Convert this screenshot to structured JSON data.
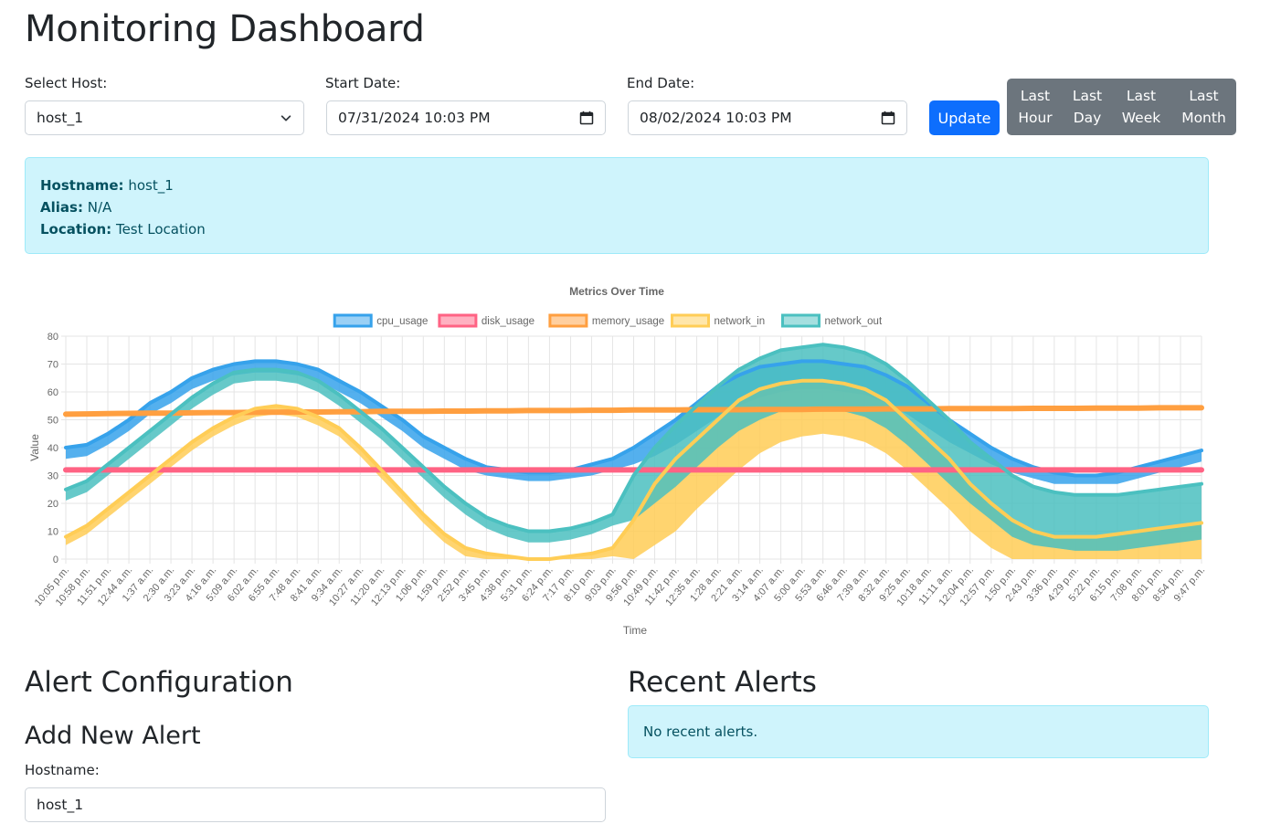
{
  "page": {
    "title": "Monitoring Dashboard"
  },
  "filters": {
    "host_label": "Select Host:",
    "host_value": "host_1",
    "start_label": "Start Date:",
    "start_value": "07/31/2024 10:03  PM",
    "end_label": "End Date:",
    "end_value": "08/02/2024 10:03  PM",
    "update_label": "Update",
    "ranges": [
      {
        "label": "Last\nHour"
      },
      {
        "label": "Last\nDay"
      },
      {
        "label": "Last\nWeek"
      },
      {
        "label": "Last\nMonth"
      }
    ]
  },
  "host_info": {
    "hostname_key": "Hostname:",
    "hostname_val": "host_1",
    "alias_key": "Alias:",
    "alias_val": "N/A",
    "location_key": "Location:",
    "location_val": "Test Location"
  },
  "chart_data": {
    "type": "line",
    "title": "Metrics Over Time",
    "xlabel": "Time",
    "ylabel": "Value",
    "ylim": [
      0,
      80
    ],
    "yticks": [
      0,
      10,
      20,
      30,
      40,
      50,
      60,
      70,
      80
    ],
    "grid": true,
    "legend_position": "top",
    "x_ticks": [
      "10:05 p.m.",
      "10:58 p.m.",
      "11:51 p.m.",
      "12:44 a.m.",
      "1:37 a.m.",
      "2:30 a.m.",
      "3:23 a.m.",
      "4:16 a.m.",
      "5:09 a.m.",
      "6:02 a.m.",
      "6:55 a.m.",
      "7:48 a.m.",
      "8:41 a.m.",
      "9:34 a.m.",
      "10:27 a.m.",
      "11:20 a.m.",
      "12:13 p.m.",
      "1:06 p.m.",
      "1:59 p.m.",
      "2:52 p.m.",
      "3:45 p.m.",
      "4:38 p.m.",
      "5:31 p.m.",
      "6:24 p.m.",
      "7:17 p.m.",
      "8:10 p.m.",
      "9:03 p.m.",
      "9:56 p.m.",
      "10:49 p.m.",
      "11:42 p.m.",
      "12:35 a.m.",
      "1:28 a.m.",
      "2:21 a.m.",
      "3:14 a.m.",
      "4:07 a.m.",
      "5:00 a.m.",
      "5:53 a.m.",
      "6:46 a.m.",
      "7:39 a.m.",
      "8:32 a.m.",
      "9:25 a.m.",
      "10:18 a.m.",
      "11:11 a.m.",
      "12:04 p.m.",
      "12:57 p.m.",
      "1:50 p.m.",
      "2:43 p.m.",
      "3:36 p.m.",
      "4:29 p.m.",
      "5:22 p.m.",
      "6:15 p.m.",
      "7:08 p.m.",
      "8:01 p.m.",
      "8:54 p.m.",
      "9:47 p.m."
    ],
    "series": [
      {
        "name": "cpu_usage",
        "color": "#36a2eb",
        "fill": "#9ad0f5",
        "values": [
          40,
          41,
          45,
          50,
          56,
          60,
          65,
          68,
          70,
          71,
          71,
          70,
          68,
          64,
          60,
          55,
          50,
          44,
          40,
          36,
          33,
          32,
          31,
          31,
          32,
          34,
          36,
          40,
          45,
          50,
          56,
          62,
          66,
          69,
          70,
          71,
          71,
          70,
          69,
          66,
          62,
          56,
          50,
          45,
          40,
          36,
          33,
          31,
          30,
          30,
          31,
          33,
          35,
          37,
          39
        ],
        "band_min": [
          36,
          37,
          41,
          46,
          52,
          56,
          61,
          64,
          66,
          67,
          67,
          66,
          64,
          60,
          56,
          51,
          46,
          40,
          36,
          32,
          30,
          29,
          28,
          28,
          29,
          30,
          32,
          34,
          37,
          41,
          46,
          51,
          55,
          58,
          60,
          61,
          61,
          60,
          59,
          56,
          52,
          47,
          42,
          38,
          34,
          31,
          29,
          27,
          27,
          27,
          27,
          29,
          31,
          33,
          35
        ]
      },
      {
        "name": "disk_usage",
        "color": "#ff6384",
        "fill": "#ffb1c1",
        "values": [
          32,
          32,
          32,
          32,
          32,
          32,
          32,
          32,
          32,
          32,
          32,
          32,
          32,
          32,
          32,
          32,
          32,
          32,
          32,
          32,
          32,
          32,
          32,
          32,
          32,
          32,
          32,
          32,
          32,
          32,
          32,
          32,
          32,
          32,
          32,
          32,
          32,
          32,
          32,
          32,
          32,
          32,
          32,
          32,
          32,
          32,
          32,
          32,
          32,
          32,
          32,
          32,
          32,
          32,
          32
        ]
      },
      {
        "name": "memory_usage",
        "color": "#ff9f40",
        "fill": "#ffcf9f",
        "values": [
          52,
          52.1,
          52.2,
          52.3,
          52.4,
          52.4,
          52.5,
          52.6,
          52.6,
          52.7,
          52.7,
          52.8,
          52.8,
          52.9,
          52.9,
          53,
          53,
          53,
          53.1,
          53.1,
          53.2,
          53.2,
          53.3,
          53.3,
          53.3,
          53.4,
          53.4,
          53.5,
          53.5,
          53.5,
          53.6,
          53.6,
          53.6,
          53.7,
          53.7,
          53.7,
          53.8,
          53.8,
          53.8,
          53.9,
          53.9,
          53.9,
          54,
          54,
          54,
          54,
          54.1,
          54.1,
          54.1,
          54.2,
          54.2,
          54.2,
          54.3,
          54.3,
          54.3
        ]
      },
      {
        "name": "network_in",
        "color": "#ffcd56",
        "fill": "#ffe6aa",
        "values": [
          8,
          12,
          18,
          24,
          30,
          36,
          42,
          47,
          51,
          54,
          55,
          54,
          51,
          47,
          40,
          32,
          24,
          16,
          9,
          4,
          2,
          1,
          0,
          0,
          1,
          2,
          4,
          14,
          27,
          36,
          43,
          50,
          57,
          61,
          63,
          64,
          64,
          63,
          61,
          57,
          50,
          43,
          36,
          27,
          20,
          14,
          10,
          8,
          8,
          8,
          9,
          10,
          11,
          12,
          13
        ],
        "band_min": [
          5,
          9,
          15,
          21,
          27,
          33,
          39,
          44,
          48,
          51,
          52,
          51,
          48,
          44,
          37,
          29,
          21,
          13,
          6,
          1,
          0,
          0,
          0,
          0,
          0,
          0,
          1,
          0,
          5,
          10,
          18,
          25,
          32,
          38,
          42,
          44,
          45,
          44,
          42,
          38,
          32,
          25,
          18,
          10,
          4,
          0,
          0,
          0,
          0,
          0,
          0,
          0,
          0,
          0,
          0
        ]
      },
      {
        "name": "network_out",
        "color": "#4bc0c0",
        "fill": "#a5dfdf",
        "values": [
          25,
          28,
          34,
          40,
          46,
          52,
          58,
          63,
          67,
          68,
          68,
          67,
          64,
          59,
          53,
          47,
          40,
          33,
          26,
          20,
          15,
          12,
          10,
          10,
          11,
          13,
          16,
          30,
          40,
          48,
          55,
          62,
          68,
          72,
          75,
          76,
          77,
          76,
          74,
          70,
          64,
          57,
          50,
          42,
          36,
          30,
          26,
          24,
          23,
          23,
          23,
          24,
          25,
          26,
          27
        ],
        "band_min": [
          21,
          24,
          30,
          36,
          42,
          48,
          54,
          59,
          63,
          64,
          64,
          63,
          60,
          55,
          49,
          43,
          36,
          29,
          22,
          16,
          11,
          8,
          6,
          6,
          7,
          9,
          12,
          14,
          20,
          26,
          33,
          40,
          46,
          50,
          53,
          54,
          54,
          53,
          51,
          47,
          41,
          34,
          27,
          20,
          14,
          8,
          5,
          4,
          3,
          3,
          3,
          4,
          5,
          6,
          7
        ]
      }
    ]
  },
  "alerts": {
    "config_title": "Alert Configuration",
    "add_title": "Add New Alert",
    "hostname_label": "Hostname:",
    "hostname_value": "host_1",
    "recent_title": "Recent Alerts",
    "recent_empty": "No recent alerts."
  },
  "colors": {
    "primary": "#0d6efd",
    "secondary": "#6c757d",
    "info_bg": "#cff4fc",
    "info_text": "#055160"
  }
}
